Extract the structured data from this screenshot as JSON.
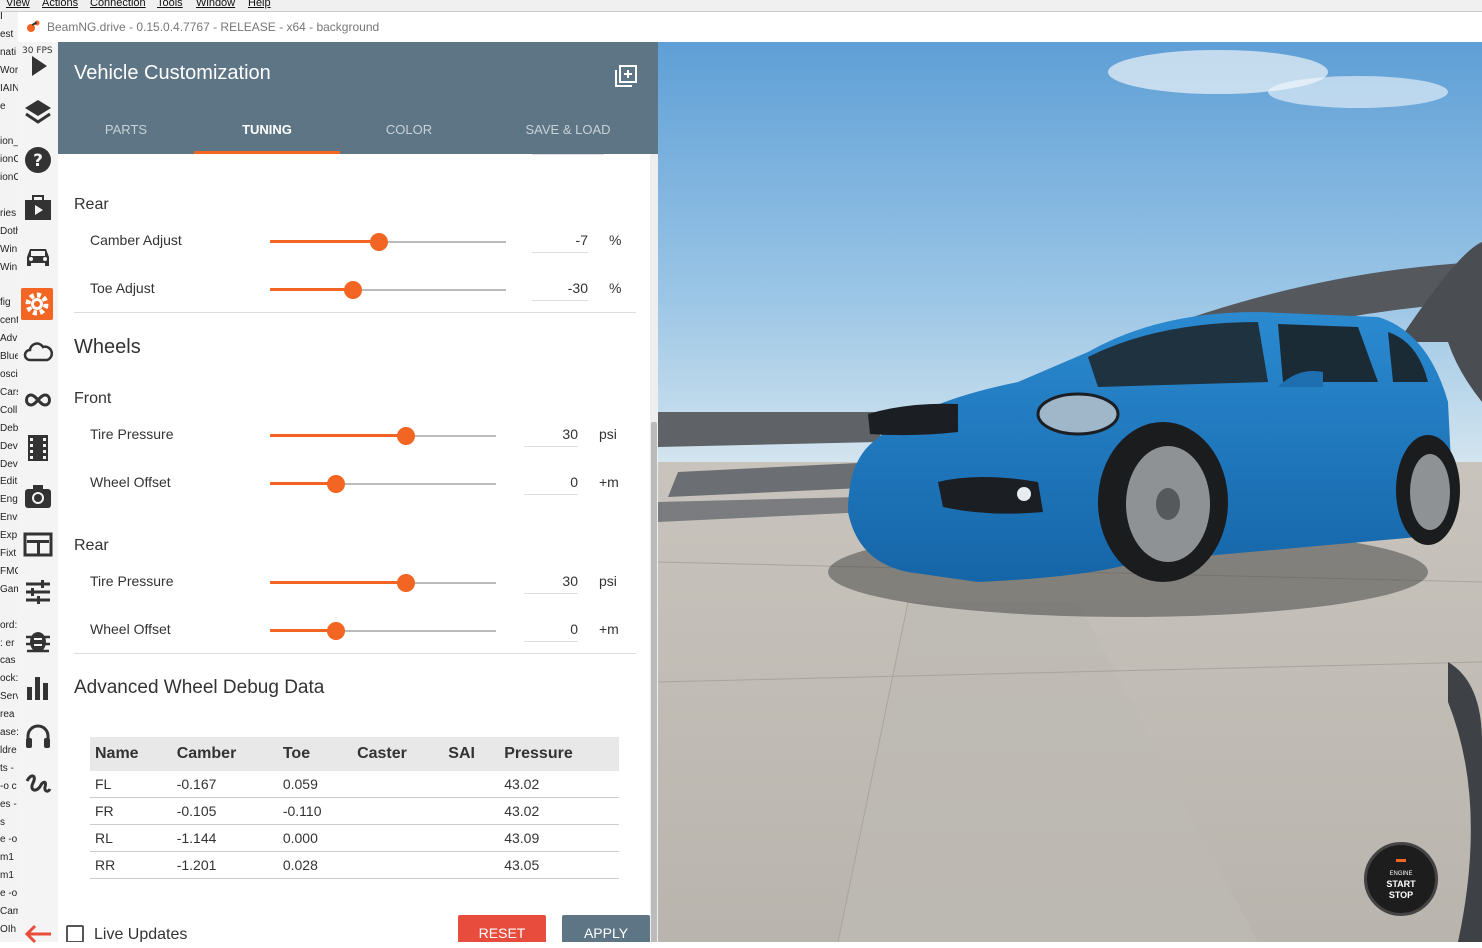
{
  "host_menu": [
    "View",
    "Actions",
    "Connection",
    "Tools",
    "Window",
    "Help"
  ],
  "bg_window_lines": [
    "I",
    "est",
    "nati",
    "Wor",
    "IAIN",
    "e",
    "",
    "ion_",
    "ionC",
    "ionC",
    "",
    "ries",
    "Doth",
    "Win",
    "Win",
    "",
    "fig",
    "cent",
    "Adv",
    "Blue",
    "osci",
    "Cars",
    "Coll",
    "Deb",
    "Dev",
    "Dev",
    "Edit",
    "Engi",
    "Envi",
    "Exp",
    "Fixt",
    "FMC",
    "Gam",
    "",
    "ord:",
    ": er",
    "cas",
    "ock:",
    "Serv",
    "rea",
    "ase:",
    "ldre",
    "ts -",
    "-o c",
    "es -",
    "s",
    "e -o",
    "m1",
    "m1",
    "e -o",
    "Cam",
    "OIh"
  ],
  "window": {
    "title": "BeamNG.drive - 0.15.0.4.7767 - RELEASE - x64 - background",
    "fps": "30 FPS"
  },
  "toolbar_icons": [
    "play-icon",
    "layers-icon",
    "help-icon",
    "scenario-icon",
    "car-icon",
    "gear-icon",
    "cloud-icon",
    "infinity-icon",
    "film-icon",
    "camera-icon",
    "dashboard-icon",
    "tune-icon",
    "bug-icon",
    "chart-icon",
    "headphones-icon",
    "signature-icon",
    "back-arrow-icon"
  ],
  "accent": "#f26522",
  "panel": {
    "title": "Vehicle Customization",
    "tabs": [
      "PARTS",
      "TUNING",
      "COLOR",
      "SAVE & LOAD"
    ],
    "active_tab": "TUNING"
  },
  "tuning": {
    "rear_alignment": {
      "heading": "Rear",
      "rows": [
        {
          "label": "Camber Adjust",
          "value": "-7",
          "unit": "%",
          "level": 0.46
        },
        {
          "label": "Toe Adjust",
          "value": "-30",
          "unit": "%",
          "level": 0.35
        }
      ]
    },
    "wheels": {
      "heading": "Wheels",
      "front": {
        "heading": "Front",
        "rows": [
          {
            "label": "Tire Pressure",
            "value": "30",
            "unit": "psi",
            "level": 0.6
          },
          {
            "label": "Wheel Offset",
            "value": "0",
            "unit": "+m",
            "level": 0.29
          }
        ]
      },
      "rear": {
        "heading": "Rear",
        "rows": [
          {
            "label": "Tire Pressure",
            "value": "30",
            "unit": "psi",
            "level": 0.6
          },
          {
            "label": "Wheel Offset",
            "value": "0",
            "unit": "+m",
            "level": 0.29
          }
        ]
      }
    }
  },
  "debug": {
    "heading": "Advanced Wheel Debug Data",
    "columns": [
      "Name",
      "Camber",
      "Toe",
      "Caster",
      "SAI",
      "Pressure"
    ],
    "rows": [
      [
        "FL",
        "-0.167",
        "0.059",
        "",
        "",
        "43.02"
      ],
      [
        "FR",
        "-0.105",
        "-0.110",
        "",
        "",
        "43.02"
      ],
      [
        "RL",
        "-1.144",
        "0.000",
        "",
        "",
        "43.09"
      ],
      [
        "RR",
        "-1.201",
        "0.028",
        "",
        "",
        "43.05"
      ]
    ]
  },
  "footer": {
    "live_updates": "Live Updates",
    "live_updates_checked": false,
    "reset": "RESET",
    "apply": "APPLY"
  },
  "engine_button": {
    "line1": "ENGINE",
    "line2": "START",
    "line3": "STOP"
  },
  "car_color": "#1e7fc6"
}
